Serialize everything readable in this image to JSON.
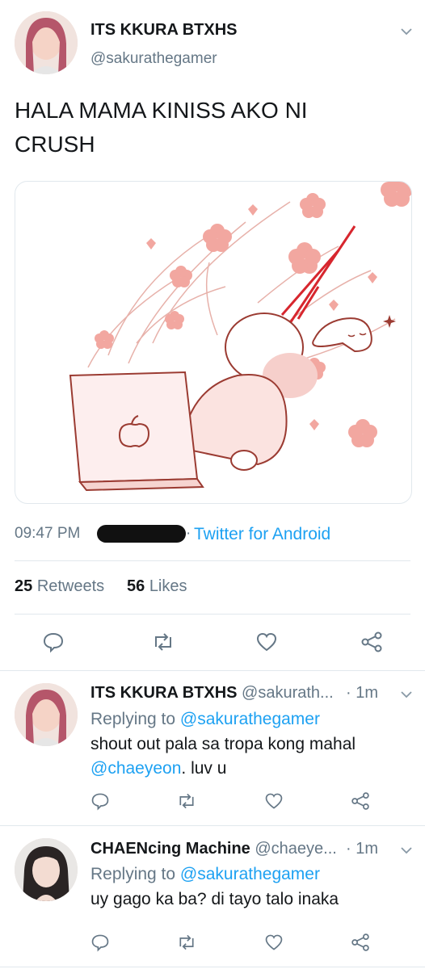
{
  "tweet": {
    "display_name": "ITS KKURA BTXHS",
    "handle": "@sakurathegamer",
    "text_line1": "HALA MAMA KINISS AKO NI",
    "text_line2": "CRUSH",
    "time": "09:47 PM",
    "source": "Twitter for Android",
    "retweets_count": "25",
    "retweets_label": "Retweets",
    "likes_count": "56",
    "likes_label": "Likes"
  },
  "replies": [
    {
      "display_name": "ITS KKURA BTXHS",
      "handle": "@sakurath...",
      "time": "· 1m",
      "replying_prefix": "Replying to",
      "replying_to": "@sakurathegamer",
      "text_line1": "shout out pala sa tropa kong mahal",
      "mention": "@chaeyeon",
      "text_tail": ". luv u"
    },
    {
      "display_name": "CHAENcing Machine",
      "handle": "@chaeye...",
      "time": "· 1m",
      "replying_prefix": "Replying to",
      "replying_to": "@sakurathegamer",
      "text_line1": "uy gago ka ba? di tayo talo inaka"
    }
  ],
  "colors": {
    "accent": "#1da1f2",
    "secondary_text": "#657786",
    "divider": "#e1e8ed",
    "petal": "#f2a7a0"
  }
}
